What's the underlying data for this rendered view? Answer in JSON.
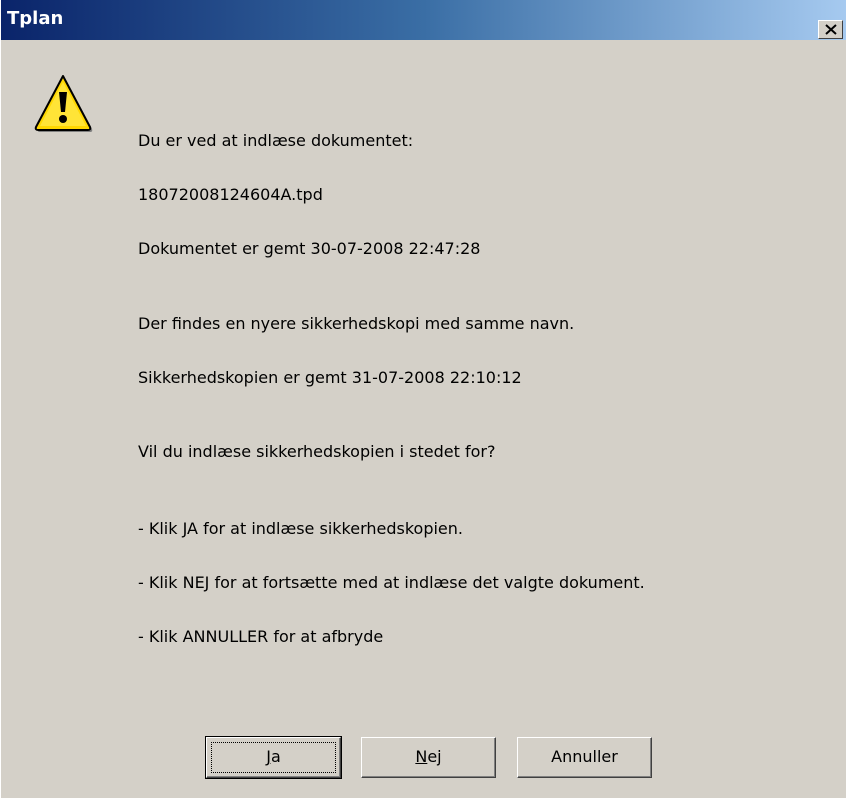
{
  "window": {
    "title": "Tplan",
    "close_symbol": "×"
  },
  "icon": {
    "name": "warning-icon",
    "fill": "#ffd700",
    "mark": "!"
  },
  "message": {
    "lines": [
      "Du er ved at indlæse dokumentet:",
      "18072008124604A.tpd",
      "Dokumentet er gemt 30-07-2008 22:47:28",
      "Der findes en nyere sikkerhedskopi med samme navn.",
      "Sikkerhedskopien er gemt 31-07-2008 22:10:12",
      "Vil du indlæse sikkerhedskopien i stedet for?",
      "- Klik JA for at indlæse sikkerhedskopien.",
      "- Klik NEJ for at fortsætte med at indlæse det valgte dokument.",
      "- Klik ANNULLER for at afbryde"
    ]
  },
  "buttons": {
    "yes": {
      "mnemonic": "J",
      "rest": "a"
    },
    "no": {
      "mnemonic": "N",
      "rest": "ej"
    },
    "cancel": {
      "label": "Annuller"
    }
  },
  "colors": {
    "dialog_bg": "#d4d0c8",
    "title_gradient_start": "#0a246a",
    "title_gradient_end": "#a6caf0",
    "warning_yellow": "#ffd700"
  }
}
